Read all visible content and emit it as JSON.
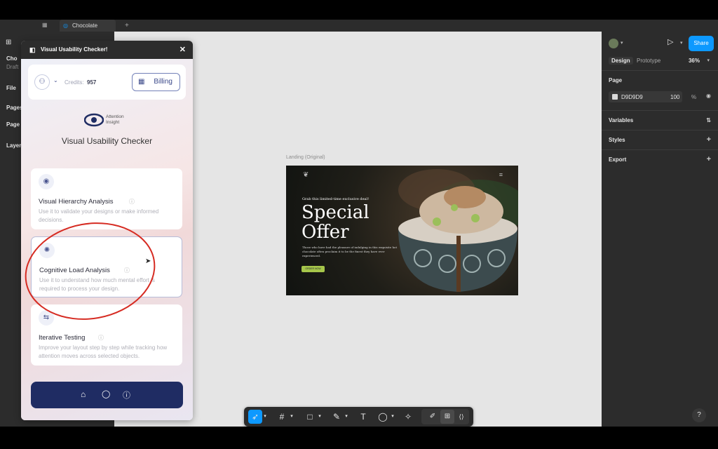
{
  "app": {
    "tab_title": "Chocolate",
    "file_name_partial": "Cho",
    "drafts_partial": "Draft",
    "left_items": [
      "File",
      "Pages",
      "Page",
      "Layer"
    ]
  },
  "right_panel": {
    "tabs": [
      "Design",
      "Prototype"
    ],
    "zoom": "36%",
    "share_label": "Share",
    "page_section": "Page",
    "page_color": "D9D9D9",
    "page_opacity": "100",
    "page_opacity_unit": "%",
    "variables": "Variables",
    "styles": "Styles",
    "export": "Export"
  },
  "plugin": {
    "title": "Visual Usability Checker!",
    "credits_label": "Credits:",
    "credits_value": "957",
    "billing_label": "Billing",
    "brand_line1": "Attention",
    "brand_line2": "Insight",
    "heading": "Visual Usability Checker",
    "features": [
      {
        "title": "Visual Hierarchy Analysis",
        "desc": "Use it to validate your designs or make informed decisions."
      },
      {
        "title": "Cognitive Load Analysis",
        "desc": "Use it to understand how much mental effort is required to process your design."
      },
      {
        "title": "Iterative Testing",
        "desc": "Improve your layout step by step while tracking how attention moves across selected objects."
      }
    ]
  },
  "canvas": {
    "frame_label": "Landing (Original)",
    "landing": {
      "eyebrow": "Grab this limited-time exclusive deal!",
      "headline_1": "Special",
      "headline_2": "Offer",
      "body": "Those who have had the pleasure of indulging in this exquisite hot chocolate often proclaim it to be the finest they have ever experienced.",
      "cta": "ORDER NOW"
    }
  },
  "help_label": "?",
  "colors": {
    "accent": "#0d99ff",
    "plugin_nav": "#1f2c63",
    "annotation": "#d62b22",
    "cta": "#a6c64a"
  }
}
